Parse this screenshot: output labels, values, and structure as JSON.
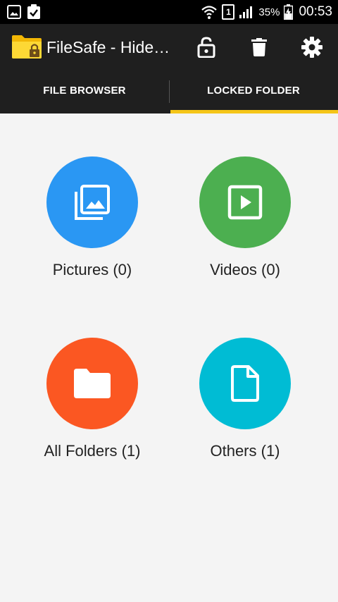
{
  "status_bar": {
    "sim": "1",
    "battery": "35%",
    "time": "00:53"
  },
  "app_bar": {
    "title": "FileSafe - Hide…",
    "icons": [
      "unlock-icon",
      "trash-icon",
      "gear-icon"
    ]
  },
  "tabs": [
    {
      "label": "FILE BROWSER",
      "active": false
    },
    {
      "label": "LOCKED FOLDER",
      "active": true
    }
  ],
  "categories": [
    {
      "label": "Pictures (0)",
      "color": "#2a97f3",
      "icon": "pictures-icon"
    },
    {
      "label": "Videos (0)",
      "color": "#4caf50",
      "icon": "video-icon"
    },
    {
      "label": "All Folders (1)",
      "color": "#fb5722",
      "icon": "folder-icon"
    },
    {
      "label": "Others (1)",
      "color": "#00bcd4",
      "icon": "file-icon"
    }
  ],
  "colors": {
    "accent": "#f5c518",
    "bar_bg": "#1f1f1f",
    "content_bg": "#f4f4f4"
  }
}
